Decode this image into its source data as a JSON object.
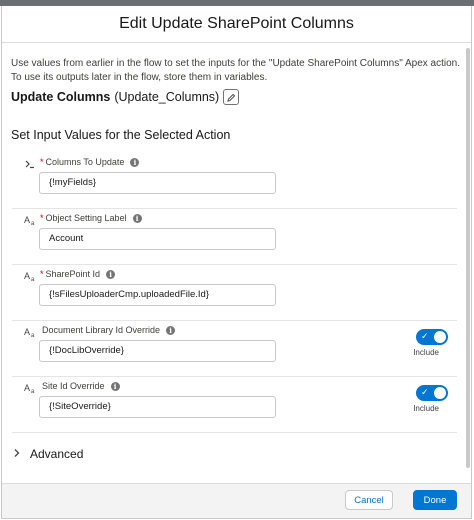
{
  "modal": {
    "title": "Edit Update SharePoint Columns",
    "description": "Use values from earlier in the flow to set the inputs for the \"Update SharePoint Columns\" Apex action. To use its outputs later in the flow, store them in variables.",
    "action_label": "Update Columns",
    "action_api_name": "(Update_Columns)",
    "section_title": "Set Input Values for the Selected Action",
    "fields": [
      {
        "label": "Columns To Update",
        "required": "*",
        "icon": "formula-icon",
        "value": "{!myFields}"
      },
      {
        "label": "Object Setting Label",
        "required": "*",
        "icon": "text-icon",
        "value": "Account"
      },
      {
        "label": "SharePoint Id",
        "required": "*",
        "icon": "text-icon",
        "value": "{!sFilesUploaderCmp.uploadedFile.Id}"
      },
      {
        "label": "Document Library Id Override",
        "required": "",
        "icon": "text-icon",
        "value": "{!DocLibOverride}",
        "include": true,
        "include_label": "Include"
      },
      {
        "label": "Site Id Override",
        "required": "",
        "icon": "text-icon",
        "value": "{!SiteOverride}",
        "include": true,
        "include_label": "Include"
      }
    ],
    "advanced_label": "Advanced",
    "footer": {
      "cancel_label": "Cancel",
      "done_label": "Done"
    }
  },
  "colors": {
    "brand": "#0176d3",
    "required": "#ba0517"
  }
}
